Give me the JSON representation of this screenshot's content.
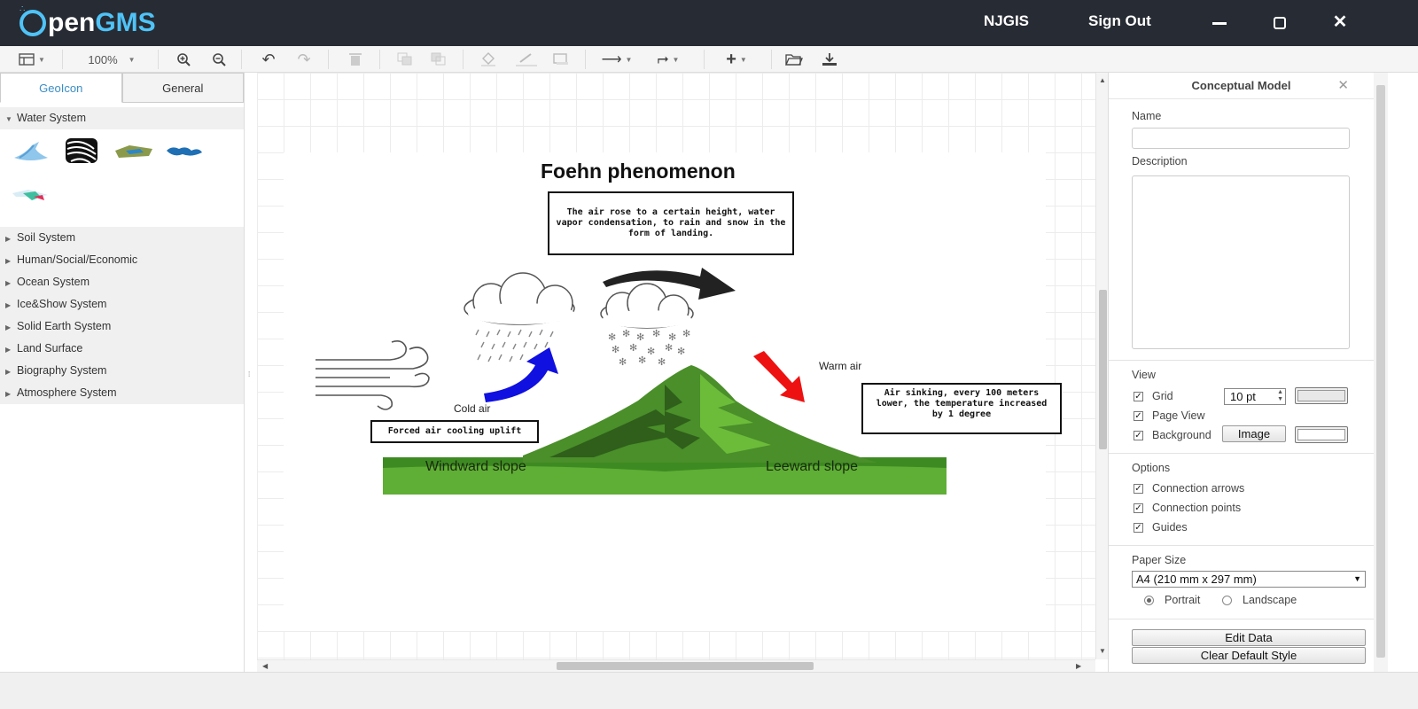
{
  "app": {
    "logo_pen": "pen",
    "logo_gms": "GMS",
    "user": "NJGIS",
    "signout": "Sign Out"
  },
  "toolbar": {
    "zoom": "100%"
  },
  "left": {
    "tabs": [
      {
        "label": "GeoIcon"
      },
      {
        "label": "General"
      }
    ],
    "expanded_category": "Water System",
    "categories": [
      {
        "label": "Soil System"
      },
      {
        "label": "Human/Social/Economic"
      },
      {
        "label": "Ocean System"
      },
      {
        "label": "Ice&Show System"
      },
      {
        "label": "Solid Earth System"
      },
      {
        "label": "Land Surface"
      },
      {
        "label": "Biography System"
      },
      {
        "label": "Atmosphere System"
      }
    ]
  },
  "diagram": {
    "title": "Foehn phenomenon",
    "note_top": "The air rose to a certain height, water vapor condensation, to rain and snow in the form of landing.",
    "note_right": "Air sinking, every 100 meters lower, the temperature increased by 1 degree",
    "note_left": "Forced air cooling uplift",
    "cold_air": "Cold air",
    "warm_air": "Warm air",
    "windward": "Windward slope",
    "leeward": "Leeward slope"
  },
  "right": {
    "title": "Conceptual Model",
    "name_label": "Name",
    "name_value": "",
    "desc_label": "Description",
    "desc_value": "",
    "view_label": "View",
    "grid_label": "Grid",
    "grid_size": "10 pt",
    "page_view_label": "Page View",
    "background_label": "Background",
    "image_button": "Image",
    "options_label": "Options",
    "opt_arrows": "Connection arrows",
    "opt_points": "Connection points",
    "opt_guides": "Guides",
    "paper_label": "Paper Size",
    "paper_value": "A4 (210 mm x 297 mm)",
    "portrait": "Portrait",
    "landscape": "Landscape",
    "edit_data": "Edit Data",
    "clear_style": "Clear Default Style"
  },
  "colors": {
    "titlebar": "#272b33",
    "accent": "#4fc3f7",
    "mountain_dark": "#3f7a1f",
    "mountain_light": "#6db33f",
    "arrow_blue": "#1010e0",
    "arrow_red": "#ee1111"
  }
}
